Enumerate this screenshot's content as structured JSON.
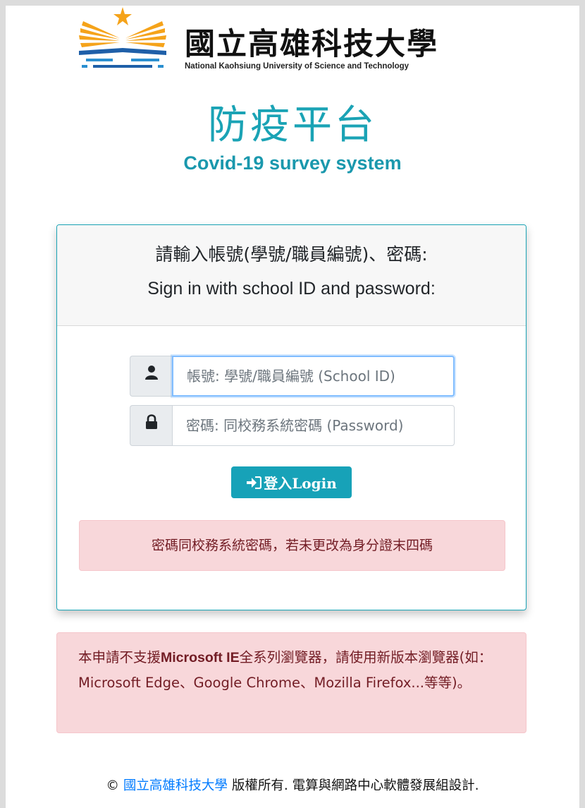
{
  "header": {
    "logo_name": "國立高雄科技大學",
    "logo_name_en": "National Kaohsiung University of Science and Technology",
    "title_cn": "防疫平台",
    "title_en": "Covid-19 survey system"
  },
  "card": {
    "heading_cn": "請輸入帳號(學號/職員編號)、密碼:",
    "heading_en": "Sign in with school ID and password:",
    "username": {
      "icon": "user-icon",
      "value": "",
      "placeholder": "帳號: 學號/職員編號 (School ID)"
    },
    "password": {
      "icon": "lock-icon",
      "value": "",
      "placeholder": "密碼: 同校務系統密碼 (Password)"
    },
    "login_button": {
      "icon": "sign-in-icon",
      "label": "登入Login"
    },
    "notice": "密碼同校務系統密碼，若未更改為身分證末四碼"
  },
  "browser_notice": {
    "prefix": "本申請不支援",
    "bold": "Microsoft IE",
    "suffix": "全系列瀏覽器，請使用新版本瀏覽器(如：Microsoft Edge、Google Chrome、Mozilla Firefox...等等)。"
  },
  "footer": {
    "copyright_symbol": "©",
    "link_text": "國立高雄科技大學",
    "rest": " 版權所有. 電算與網路中心軟體發展組設計."
  },
  "colors": {
    "accent": "#17a2b8",
    "alert_bg": "#f8d7da",
    "alert_text": "#721c24",
    "link": "#007bff"
  }
}
